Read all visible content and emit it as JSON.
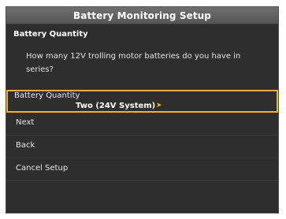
{
  "window": {
    "title": "Battery Monitoring Setup"
  },
  "section": {
    "title": "Battery Quantity"
  },
  "prompt": {
    "text": "How many 12V trolling motor batteries do you have in series?"
  },
  "menu": {
    "selected": {
      "label": "Battery Quantity",
      "value": "Two (24V System)",
      "arrow_icon": "chevron-right-icon"
    },
    "items": [
      {
        "label": "Next"
      },
      {
        "label": "Back"
      },
      {
        "label": "Cancel Setup"
      }
    ]
  },
  "colors": {
    "highlight": "#f3b21a",
    "title_bar": "#636363",
    "panel": "#2e2e2e"
  }
}
